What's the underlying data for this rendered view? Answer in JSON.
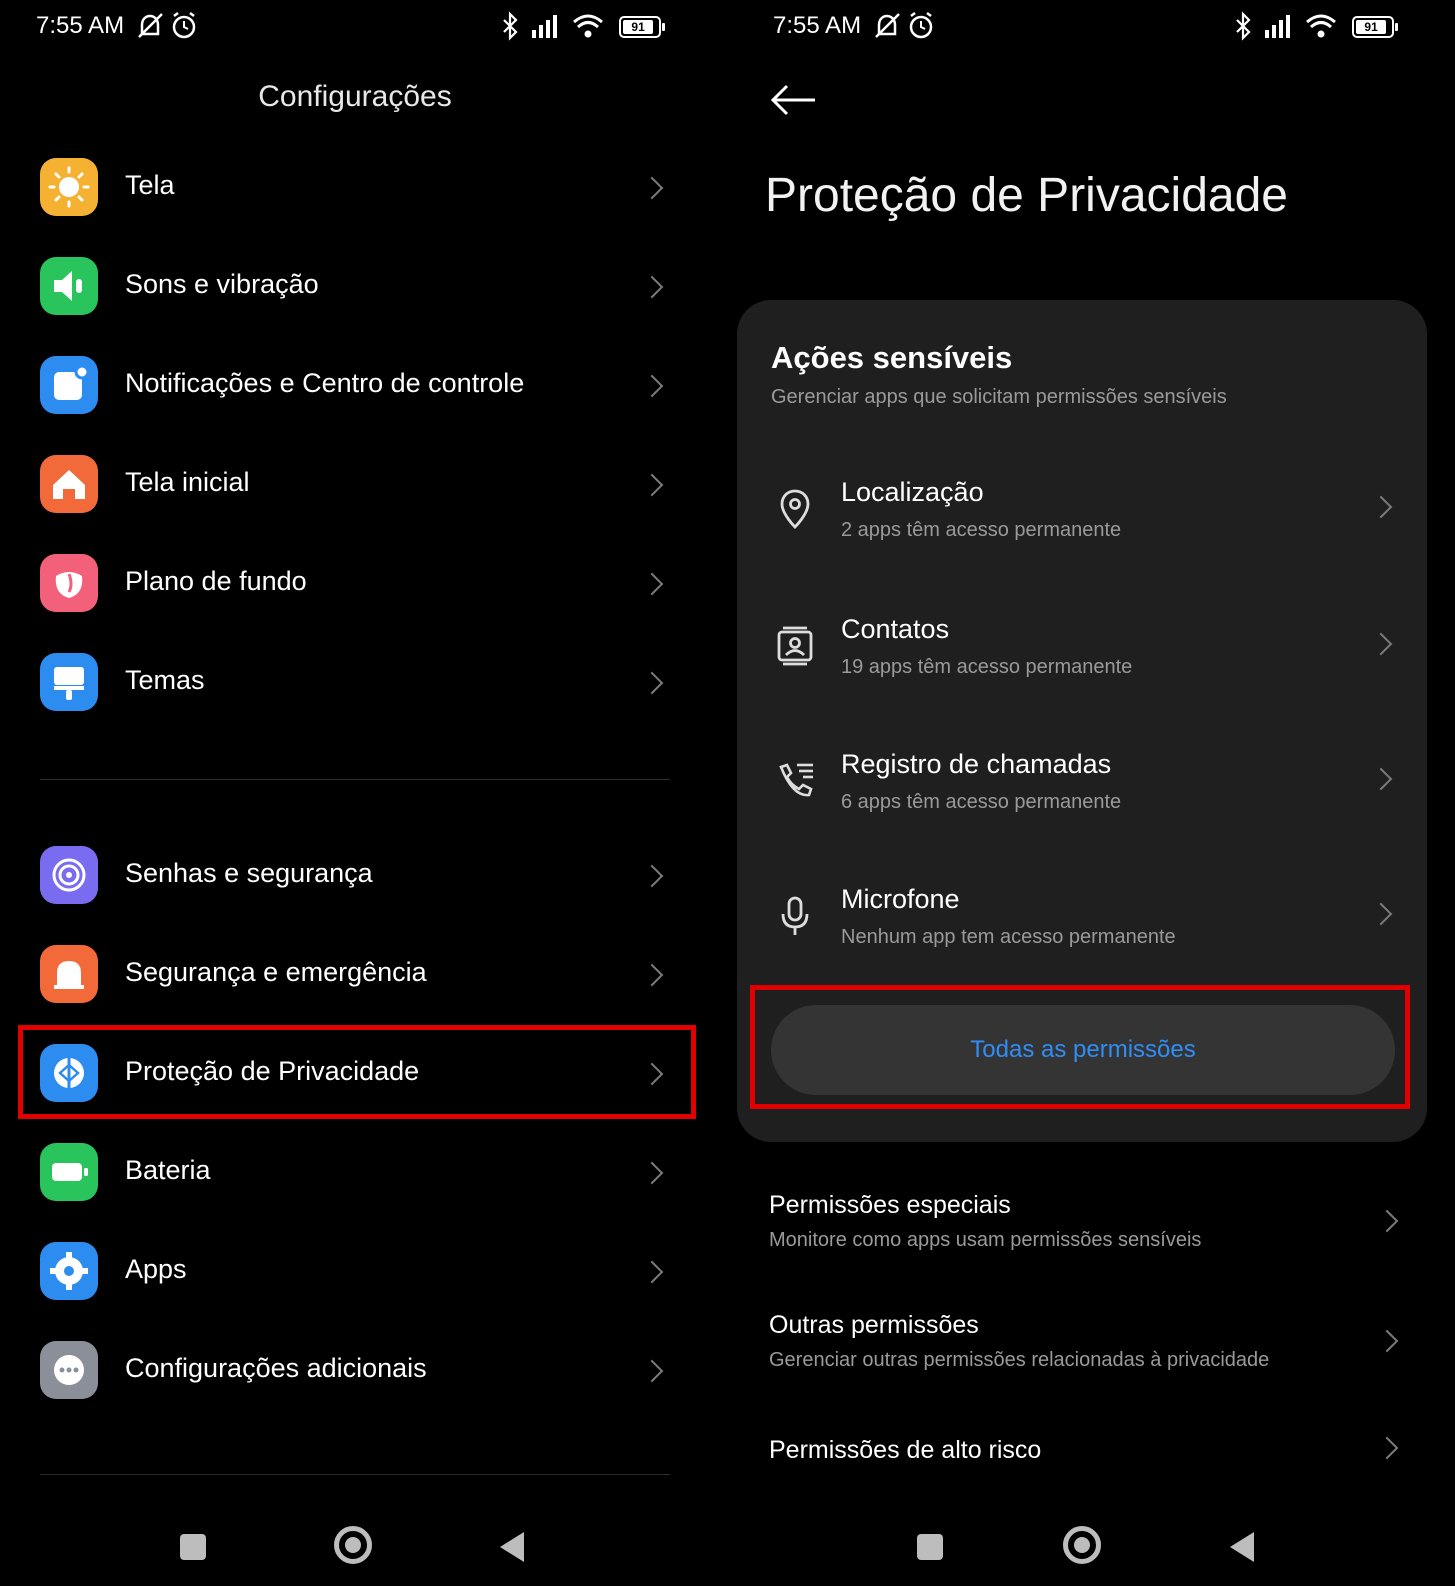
{
  "status_bar": {
    "time": "7:55 AM",
    "battery": "91"
  },
  "settings": {
    "title": "Configurações",
    "group1": [
      {
        "label": "Tela",
        "icon": "sun-icon",
        "color": "#f5b132"
      },
      {
        "label": "Sons e vibração",
        "icon": "speaker-icon",
        "color": "#29c45b"
      },
      {
        "label": "Notificações e Centro de controle",
        "icon": "notification-icon",
        "color": "#2d8cf0"
      },
      {
        "label": "Tela inicial",
        "icon": "home-icon",
        "color": "#f26a3a"
      },
      {
        "label": "Plano de fundo",
        "icon": "flower-icon",
        "color": "#f2607a"
      },
      {
        "label": "Temas",
        "icon": "brush-icon",
        "color": "#2d8cf0"
      }
    ],
    "group2": [
      {
        "label": "Senhas e segurança",
        "icon": "fingerprint-icon",
        "color": "#7a6cf0"
      },
      {
        "label": "Segurança e emergência",
        "icon": "alert-icon",
        "color": "#f26a3a"
      },
      {
        "label": "Proteção de Privacidade",
        "icon": "privacy-icon",
        "color": "#2d8cf0"
      },
      {
        "label": "Bateria",
        "icon": "battery-icon",
        "color": "#29c45b"
      },
      {
        "label": "Apps",
        "icon": "gear-icon",
        "color": "#2d8cf0"
      },
      {
        "label": "Configurações adicionais",
        "icon": "more-icon",
        "color": "#8a8f99"
      }
    ]
  },
  "privacy": {
    "title": "Proteção de Privacidade",
    "card": {
      "title": "Ações sensíveis",
      "subtitle": "Gerenciar apps que solicitam permissões sensíveis",
      "items": [
        {
          "title": "Localização",
          "subtitle": "2 apps têm acesso permanente",
          "icon": "location-pin-icon"
        },
        {
          "title": "Contatos",
          "subtitle": "19 apps têm acesso permanente",
          "icon": "contacts-icon"
        },
        {
          "title": "Registro de chamadas",
          "subtitle": "6 apps têm acesso permanente",
          "icon": "call-log-icon"
        },
        {
          "title": "Microfone",
          "subtitle": "Nenhum app tem acesso permanente",
          "icon": "microphone-icon"
        }
      ],
      "all_button": "Todas as permissões"
    },
    "list": [
      {
        "title": "Permissões especiais",
        "subtitle": "Monitore como apps usam permissões sensíveis"
      },
      {
        "title": "Outras permissões",
        "subtitle": "Gerenciar outras permissões relacionadas à privacidade"
      },
      {
        "title": "Permissões de alto risco"
      }
    ]
  },
  "colors": {
    "accent_blue": "#2f8ef6",
    "highlight_red": "#e00000",
    "card_bg": "#1f1f1f"
  }
}
